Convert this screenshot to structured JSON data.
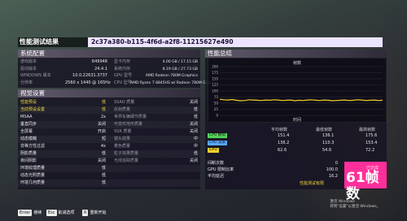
{
  "title_bar": {
    "title": "性能测试结果",
    "run_id": "2c37a380-b115-4f6d-a2f8-11215627e490"
  },
  "system": {
    "header": "系统配置",
    "rows": [
      {
        "label": "游戏版本",
        "value": "649948",
        "label2": "显卡内存",
        "value2": "4.00 GB / 17.15 GB"
      },
      {
        "label": "驱动版本",
        "value": "24.4.1",
        "label2": "系统内存",
        "value2": "8.19 GB / 27.73 GB"
      },
      {
        "label": "WINDOWS 版本",
        "value": "10.0.22631.3737",
        "label2": "GPU 型号",
        "value2": "AMD Radeon 780M Graphics"
      },
      {
        "label": "分辨率",
        "value": "2560 x 1440 @ 165Hz",
        "label2": "CPU 型号",
        "value2": "AMD Ryzen 7 8845HS w/ Radeon 780M Graphics"
      }
    ]
  },
  "video": {
    "header": "视觉设置",
    "rows": [
      {
        "left_label": "性能预设",
        "left_value": "低",
        "right_label": "SSAO 质量",
        "right_value": "关闭",
        "highlight": true
      },
      {
        "left_label": "当前预设设置",
        "left_value": "低",
        "right_label": "反射质量",
        "right_value": "低",
        "highlight": true
      },
      {
        "left_label": "MSAA",
        "left_value": "2x",
        "right_label": "世界车辆细节质量",
        "right_value": "低"
      },
      {
        "left_label": "垂直同步",
        "left_value": "关闭",
        "right_label": "可变形地形质量",
        "right_value": "关闭"
      },
      {
        "left_label": "全屏幕",
        "left_value": "开启",
        "right_label": "SSR 质量",
        "right_value": "关闭"
      },
      {
        "left_label": "动态模糊",
        "left_value": "短",
        "right_label": "镜头效果",
        "right_value": "中"
      },
      {
        "left_label": "非等方性过滤",
        "left_value": "4x",
        "right_label": "着色质量",
        "right_value": "中"
      },
      {
        "left_label": "阴影质量",
        "left_value": "低",
        "right_label": "粒子效果质量",
        "right_value": "低"
      },
      {
        "left_label": "夜间阴影",
        "left_value": "关闭",
        "right_label": "光线追踪质量",
        "right_value": "关闭"
      },
      {
        "left_label": "环境纹理质量",
        "left_value": "低",
        "right_label": "",
        "right_value": ""
      },
      {
        "left_label": "动态光照质量",
        "left_value": "低",
        "right_label": "",
        "right_value": ""
      },
      {
        "left_label": "环境几何质量",
        "left_value": "低",
        "right_label": "",
        "right_value": ""
      }
    ]
  },
  "perf": {
    "header": "性能总结"
  },
  "chart_data": {
    "type": "line",
    "title": "帧数",
    "xlabel": "时间",
    "ylabel": "",
    "ylim": [
      0,
      200
    ],
    "yticks": [
      "200",
      "175",
      "150",
      "125",
      "100",
      "75",
      "50",
      "25",
      "0"
    ],
    "series": [
      {
        "name": "GPU",
        "color": "#f2cf2b",
        "values": [
          66,
          64,
          63,
          65,
          62,
          60,
          61,
          64,
          63,
          62,
          61,
          63,
          62,
          64,
          63,
          61,
          62,
          63,
          60,
          62,
          61,
          63,
          64,
          62,
          61,
          63,
          62,
          60,
          61,
          62,
          63,
          61,
          62,
          64,
          63,
          61,
          62,
          63,
          61,
          62
        ]
      }
    ]
  },
  "stats": {
    "col_headers": [
      "平均帧数",
      "最低帧数",
      "最高帧数"
    ],
    "rows": [
      {
        "name": "CPU 模拟",
        "color": "#53d35a",
        "values": [
          "151.4",
          "136.1",
          "175.6"
        ]
      },
      {
        "name": "CPU 渲染",
        "color": "#58a8ff",
        "values": [
          "136.2",
          "110.3",
          "153.4"
        ]
      },
      {
        "name": "GPU",
        "color": "#f2cf2b",
        "values": [
          "62.6",
          "54.6",
          "72.2"
        ]
      }
    ],
    "extra": [
      {
        "label": "间断次数",
        "value": "0"
      },
      {
        "label": "GPU 限制比率",
        "value": "100.0"
      },
      {
        "label": "平均延迟",
        "value": "16.2"
      }
    ],
    "limited_label": "性能测试有限"
  },
  "fps_badge": {
    "label": "已达成",
    "value": "61帧数"
  },
  "activate": {
    "line1": "激活 Windows",
    "line2": "转到\"设置\"以激活 Windows。"
  },
  "footer": {
    "buttons": [
      {
        "key": "Enter",
        "label": "继续"
      },
      {
        "key": "Esc",
        "label": "削减选项"
      },
      {
        "key": "R",
        "label": "重新开始"
      }
    ]
  }
}
